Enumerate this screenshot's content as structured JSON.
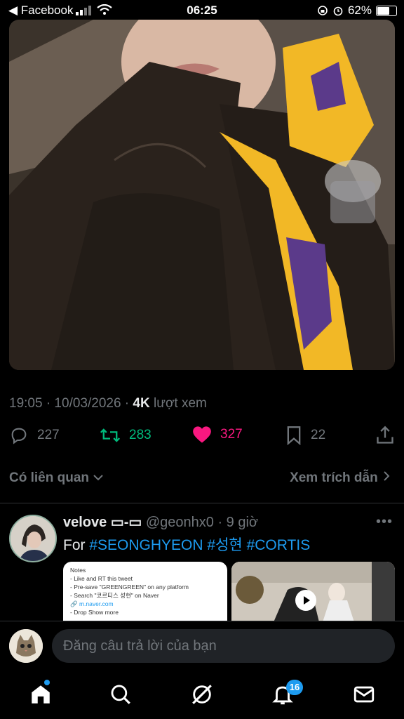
{
  "status_bar": {
    "back_app": "◀ Facebook",
    "time": "06:25",
    "battery": "62%"
  },
  "tweet": {
    "timestamp": "19:05 · 10/03/2026 · ",
    "views_count": "4K",
    "views_label": " lượt xem",
    "replies": "227",
    "retweets": "283",
    "likes": "327",
    "bookmarks": "22"
  },
  "related": {
    "left_label": "Có liên quan",
    "right_label": "Xem trích dẫn"
  },
  "reply_tweet": {
    "name": "velove ▭-▭",
    "handle": " @geonhx0",
    "time": " · 9 giờ",
    "text_prefix": "For ",
    "hashtags": [
      "#SEONGHYEON",
      "#성현",
      "#CORTIS"
    ],
    "media1_lines": [
      "Notes",
      "- Like and RT this tweet",
      "- Pre-save \"GREENGREEN\" on any platform",
      "- Search \"코르티스 성현\" on Naver",
      "🔗 m.naver.com",
      "- Drop Show more"
    ],
    "more": "•••"
  },
  "reply_bar": {
    "placeholder": "Đăng câu trả lời của bạn"
  },
  "nav": {
    "notifications_badge": "16"
  },
  "colors": {
    "accent": "#1d9bf0",
    "like": "#f91880",
    "retweet": "#00ba7c",
    "muted": "#71767b"
  }
}
